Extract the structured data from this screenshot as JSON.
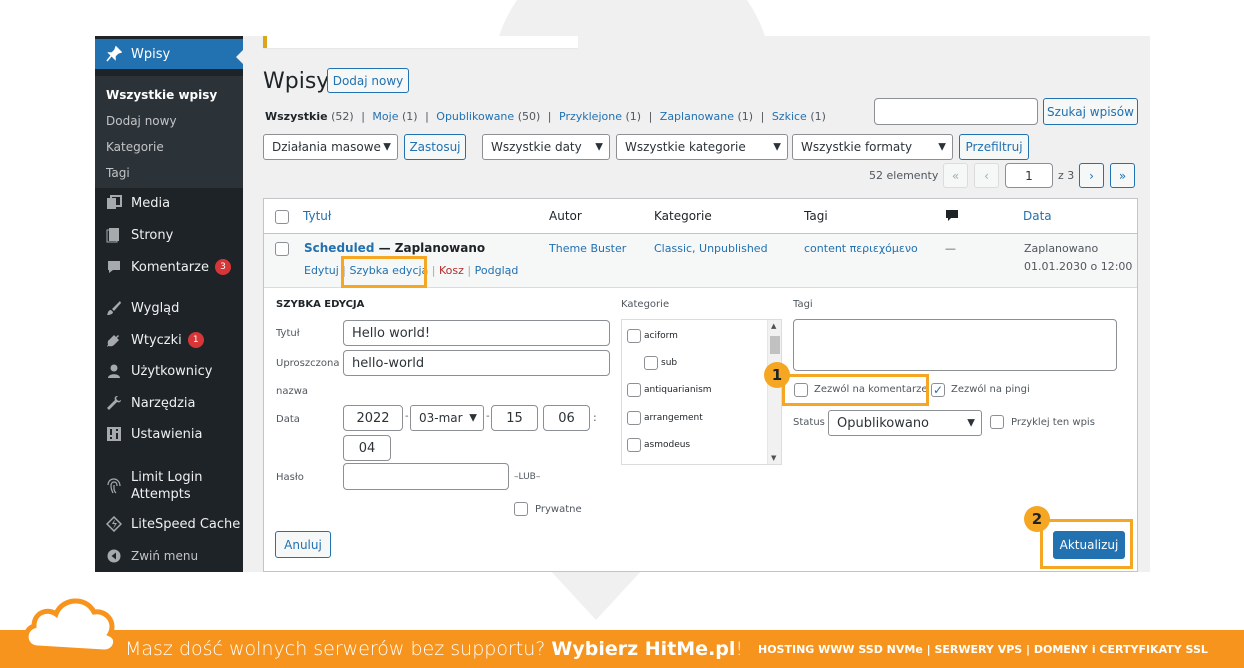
{
  "sidebar": {
    "items": [
      {
        "label": "Wpisy",
        "icon": "pin-icon"
      },
      {
        "label": "Media",
        "icon": "media-icon"
      },
      {
        "label": "Strony",
        "icon": "pages-icon"
      },
      {
        "label": "Komentarze",
        "icon": "comments-icon",
        "badge": "3"
      },
      {
        "label": "Wygląd",
        "icon": "appearance-icon"
      },
      {
        "label": "Wtyczki",
        "icon": "plugins-icon",
        "badge": "1"
      },
      {
        "label": "Użytkownicy",
        "icon": "users-icon"
      },
      {
        "label": "Narzędzia",
        "icon": "tools-icon"
      },
      {
        "label": "Ustawienia",
        "icon": "settings-icon"
      },
      {
        "label": "Limit Login",
        "label2": "Attempts",
        "icon": "fingerprint-icon"
      },
      {
        "label": "LiteSpeed Cache",
        "icon": "litespeed-icon"
      },
      {
        "label": "Zwiń menu",
        "icon": "collapse-icon"
      }
    ],
    "submenu": [
      "Wszystkie wpisy",
      "Dodaj nowy",
      "Kategorie",
      "Tagi"
    ]
  },
  "header": {
    "title": "Wpisy",
    "add_new": "Dodaj nowy"
  },
  "filters": {
    "all": "Wszystkie",
    "all_count": "(52)",
    "mine": "Moje",
    "mine_count": "(1)",
    "published": "Opublikowane",
    "published_count": "(50)",
    "sticky": "Przyklejone",
    "sticky_count": "(1)",
    "scheduled": "Zaplanowane",
    "scheduled_count": "(1)",
    "drafts": "Szkice",
    "drafts_count": "(1)",
    "sep": "|"
  },
  "search": {
    "value": "",
    "button": "Szukaj wpisów"
  },
  "toolbar": {
    "bulk_actions": "Działania masowe",
    "apply": "Zastosuj",
    "all_dates": "Wszystkie daty",
    "all_categories": "Wszystkie kategorie",
    "all_formats": "Wszystkie formaty",
    "filter": "Przefiltruj"
  },
  "pagination": {
    "count": "52 elementy",
    "first": "«",
    "prev": "‹",
    "next": "›",
    "last": "»",
    "current": "1",
    "of": "z 3"
  },
  "table": {
    "columns": {
      "title": "Tytuł",
      "author": "Autor",
      "categories": "Kategorie",
      "tags": "Tagi",
      "date": "Data"
    },
    "row": {
      "title": "Scheduled",
      "state": " — Zaplanowano",
      "actions": {
        "edit": "Edytuj",
        "quick_edit": "Szybka edycja",
        "trash": "Kosz",
        "view": "Podgląd",
        "sep": "|"
      },
      "author": "Theme Buster",
      "categories": "Classic, Unpublished",
      "tags": "content περιεχόμενο",
      "comments": "—",
      "date_status": "Zaplanowano",
      "date": "01.01.2030 o 12:00"
    }
  },
  "quick_edit": {
    "heading": "SZYBKA EDYCJA",
    "title_label": "Tytuł",
    "title_value": "Hello world!",
    "slug_label": "Uproszczona",
    "slug_label2": "nazwa",
    "slug_value": "hello-world",
    "date_label": "Data",
    "year": "2022",
    "month": "03-mar",
    "day": "15",
    "hour": "06",
    "minute": "04",
    "dash": "-",
    "colon": ":",
    "password_label": "Hasło",
    "password_value": "",
    "or": "–LUB–",
    "private": "Prywatne",
    "categories_label": "Kategorie",
    "categories": [
      "aciform",
      "sub",
      "antiquarianism",
      "arrangement",
      "asmodeus"
    ],
    "tags_label": "Tagi",
    "allow_comments": "Zezwól na komentarze",
    "allow_pings": "Zezwól na pingi",
    "status_label": "Status",
    "status_value": "Opublikowano",
    "sticky": "Przyklej ten wpis",
    "cancel": "Anuluj",
    "update": "Aktualizuj"
  },
  "callouts": {
    "one": "1",
    "two": "2"
  },
  "footer": {
    "text": "Masz dość wolnych serwerów bez supportu?",
    "cta": "Wybierz HitMe.pl",
    "bang": "!",
    "right": "HOSTING WWW SSD NVMe | SERWERY VPS | DOMENY i CERTYFIKATY SSL"
  },
  "colors": {
    "accent": "#2271b1",
    "highlight": "#f5a623",
    "footer": "#f7941d",
    "sidebar": "#1d2327"
  }
}
